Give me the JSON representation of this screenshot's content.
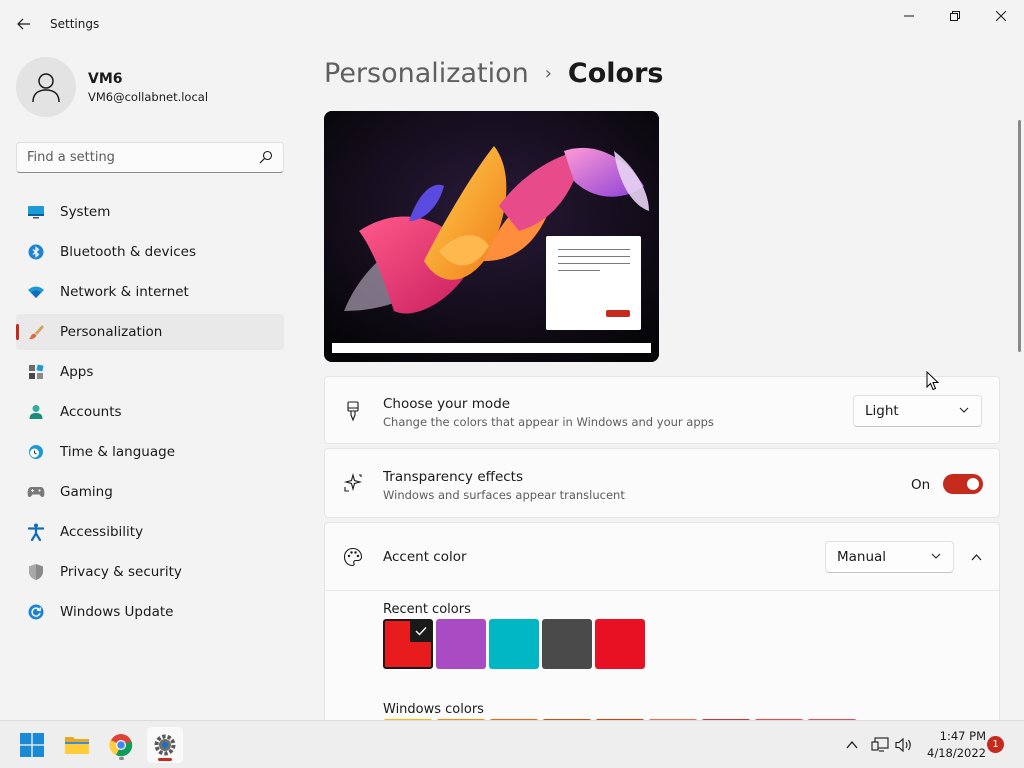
{
  "window": {
    "title": "Settings"
  },
  "profile": {
    "name": "VM6",
    "email": "VM6@collabnet.local"
  },
  "search": {
    "placeholder": "Find a setting"
  },
  "sidebar": {
    "items": [
      {
        "label": "System",
        "icon": "monitor-icon"
      },
      {
        "label": "Bluetooth & devices",
        "icon": "bluetooth-icon"
      },
      {
        "label": "Network & internet",
        "icon": "wifi-icon"
      },
      {
        "label": "Personalization",
        "icon": "brush-icon",
        "active": true
      },
      {
        "label": "Apps",
        "icon": "apps-icon"
      },
      {
        "label": "Accounts",
        "icon": "person-icon"
      },
      {
        "label": "Time & language",
        "icon": "clock-globe-icon"
      },
      {
        "label": "Gaming",
        "icon": "gamepad-icon"
      },
      {
        "label": "Accessibility",
        "icon": "accessibility-icon"
      },
      {
        "label": "Privacy & security",
        "icon": "shield-icon"
      },
      {
        "label": "Windows Update",
        "icon": "update-icon"
      }
    ]
  },
  "breadcrumb": {
    "parent": "Personalization",
    "separator": "›",
    "current": "Colors"
  },
  "mode": {
    "title": "Choose your mode",
    "description": "Change the colors that appear in Windows and your apps",
    "value": "Light"
  },
  "transparency": {
    "title": "Transparency effects",
    "description": "Windows and surfaces appear translucent",
    "state_label": "On",
    "enabled": true
  },
  "accent": {
    "title": "Accent color",
    "value": "Manual",
    "recent_label": "Recent colors",
    "recent_colors": [
      "#e81c1c",
      "#a94cc4",
      "#00b7c3",
      "#4a4a4a",
      "#e81123"
    ],
    "windows_label": "Windows colors",
    "windows_colors": [
      "#ffb900",
      "#ff8c00",
      "#f7630c",
      "#ca5010",
      "#da3b01",
      "#ef6950",
      "#d13438",
      "#ff4343",
      "#e74856"
    ]
  },
  "taskbar": {
    "apps": [
      "windows-start-icon",
      "file-explorer-icon",
      "chrome-icon",
      "settings-icon"
    ],
    "time": "1:47 PM",
    "date": "4/18/2022",
    "notifications": "1"
  },
  "colors": {
    "accent": "#c42b1c"
  }
}
